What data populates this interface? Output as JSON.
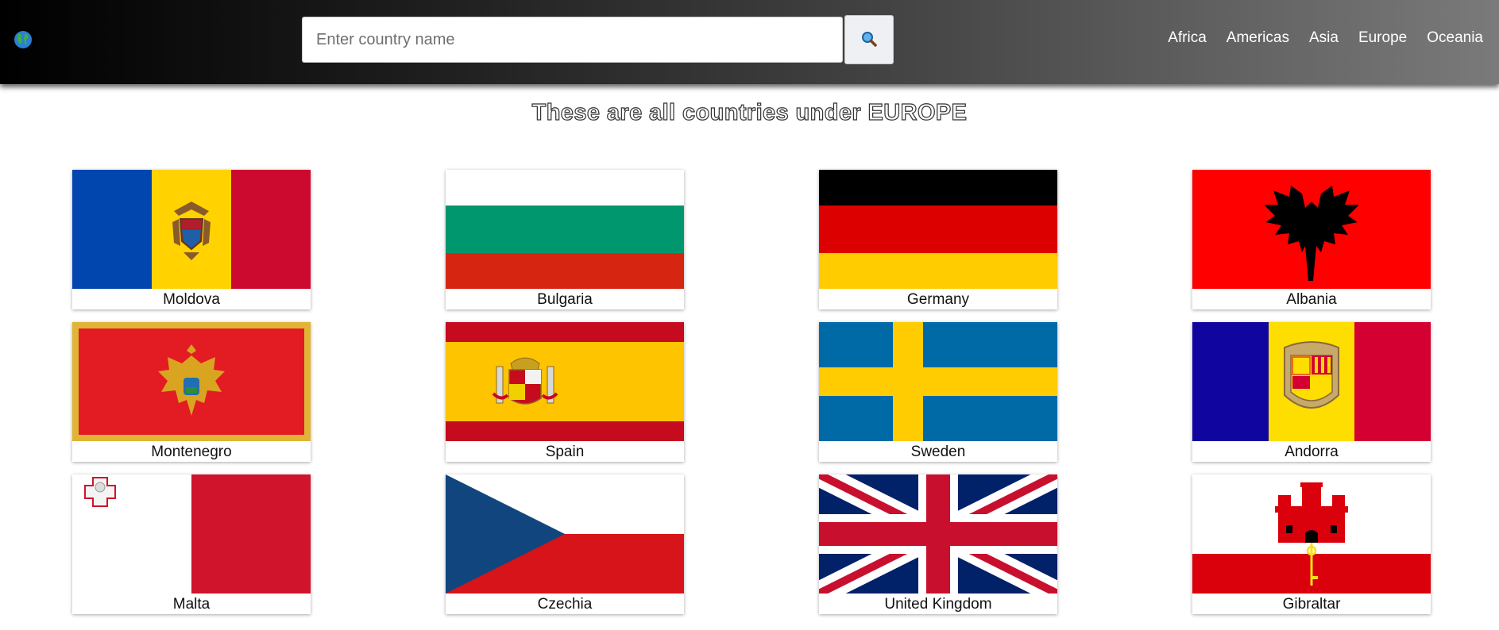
{
  "header": {
    "logo_icon": "globe-icon",
    "search": {
      "placeholder": "Enter country name",
      "value": "",
      "button_icon": "magnifier-icon"
    },
    "nav": [
      "Africa",
      "Americas",
      "Asia",
      "Europe",
      "Oceania"
    ]
  },
  "page": {
    "heading": "These are all countries under EUROPE"
  },
  "countries": [
    {
      "name": "Moldova",
      "flag_icon": "moldova-flag-icon"
    },
    {
      "name": "Bulgaria",
      "flag_icon": "bulgaria-flag-icon"
    },
    {
      "name": "Germany",
      "flag_icon": "germany-flag-icon"
    },
    {
      "name": "Albania",
      "flag_icon": "albania-flag-icon"
    },
    {
      "name": "Montenegro",
      "flag_icon": "montenegro-flag-icon"
    },
    {
      "name": "Spain",
      "flag_icon": "spain-flag-icon"
    },
    {
      "name": "Sweden",
      "flag_icon": "sweden-flag-icon"
    },
    {
      "name": "Andorra",
      "flag_icon": "andorra-flag-icon"
    },
    {
      "name": "Malta",
      "flag_icon": "malta-flag-icon"
    },
    {
      "name": "Czechia",
      "flag_icon": "czechia-flag-icon"
    },
    {
      "name": "United Kingdom",
      "flag_icon": "united-kingdom-flag-icon"
    },
    {
      "name": "Gibraltar",
      "flag_icon": "gibraltar-flag-icon"
    }
  ]
}
